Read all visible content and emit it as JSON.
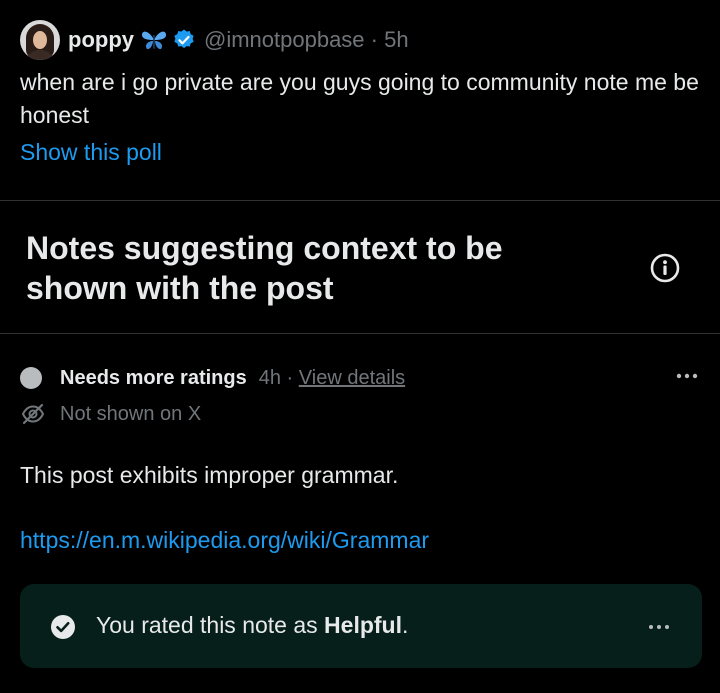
{
  "post": {
    "author_name": "poppy",
    "handle": "@imnotpopbase",
    "separator": "·",
    "time": "5h",
    "text": "when are i go private are you guys going to community note me be honest",
    "poll_link": "Show this poll"
  },
  "notes_section": {
    "title": "Notes suggesting context to be shown with the post"
  },
  "note": {
    "status": "Needs more ratings",
    "time": "4h",
    "separator": "·",
    "view_details": "View details",
    "visibility": "Not shown on X",
    "text": "This post exhibits improper grammar.",
    "link": "https://en.m.wikipedia.org/wiki/Grammar"
  },
  "rating": {
    "prefix": "You rated this note as ",
    "value": "Helpful",
    "suffix": "."
  },
  "colors": {
    "link_blue": "#1d9bf0",
    "muted_gray": "#71767b",
    "rated_box_bg": "#071f1a",
    "verified_blue": "#1d9bf0"
  },
  "icons": [
    "butterfly-emoji-icon",
    "verified-badge-icon",
    "info-icon",
    "more-icon",
    "eye-off-icon",
    "check-circle-icon"
  ]
}
